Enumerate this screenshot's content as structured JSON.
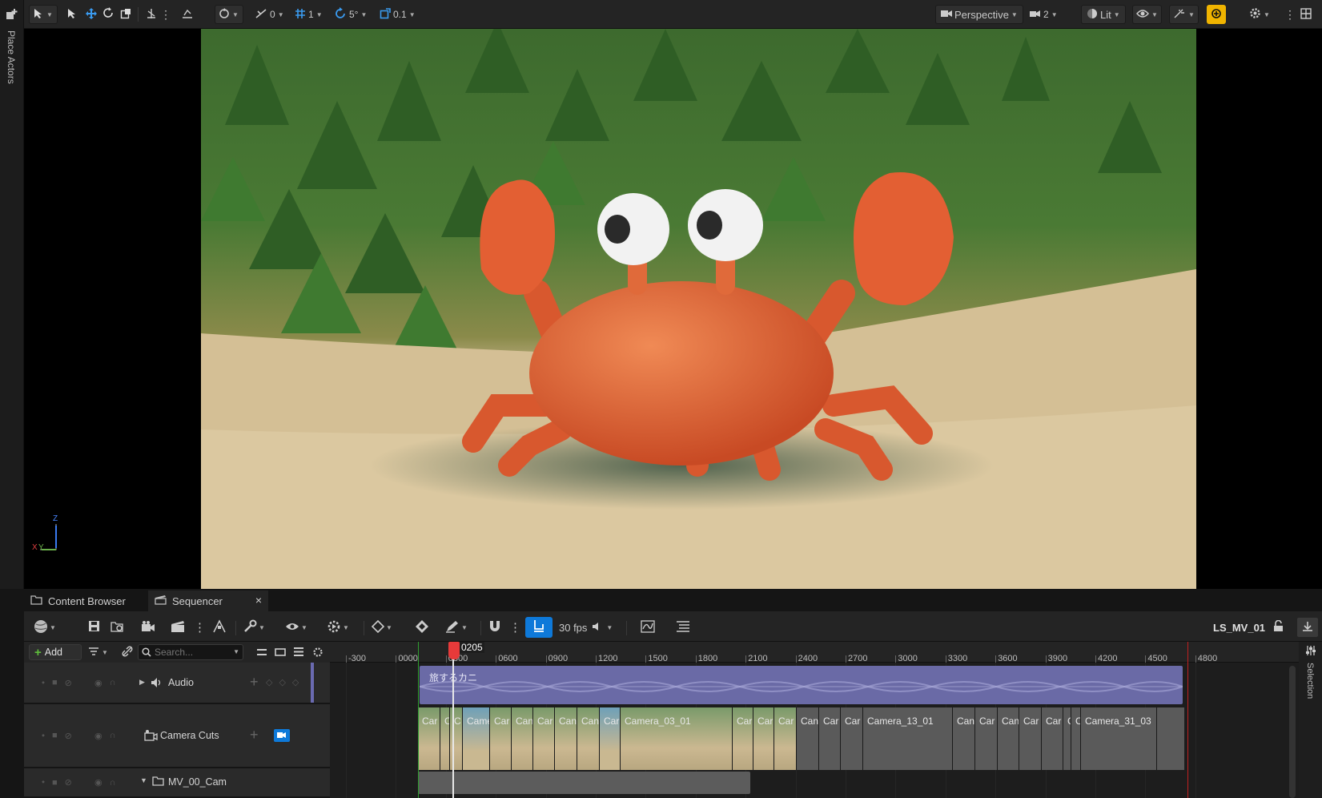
{
  "left_panel": {
    "place_actors_label": "Place Actors"
  },
  "toolbar": {
    "snap_translate": "0",
    "grid_size": "1",
    "rotation_snap": "5°",
    "scale_snap": "0.1",
    "view_mode": "Perspective",
    "camera_speed": "2",
    "lighting_mode": "Lit"
  },
  "viewport": {
    "axis_z": "Z",
    "axis_x": "X",
    "axis_y": "Y"
  },
  "tabs": [
    {
      "label": "Content Browser"
    },
    {
      "label": "Sequencer",
      "close": "×"
    }
  ],
  "sequencer": {
    "fps": "30 fps",
    "sequence_name": "LS_MV_01",
    "add_label": "Add",
    "search_placeholder": "Search...",
    "playhead_frame": "0205",
    "ruler_ticks": [
      "-300",
      "0000",
      "0300",
      "0600",
      "0900",
      "1200",
      "1500",
      "1800",
      "2100",
      "2400",
      "2700",
      "3000",
      "3300",
      "3600",
      "3900",
      "4200",
      "4500",
      "4800"
    ],
    "tracks": [
      {
        "label": "Audio"
      },
      {
        "label": "Camera Cuts"
      },
      {
        "label": "MV_00_Cam"
      }
    ],
    "audio_clip_label": "旅するカニ",
    "camera_clips": [
      "Car",
      "C",
      "C",
      "Came",
      "Car",
      "Can",
      "Car",
      "Can",
      "Can",
      "Car",
      "Camera_03_01",
      "Car",
      "Car",
      "Car",
      "Can",
      "Car",
      "Car",
      "Camera_13_01",
      "Can",
      "Car",
      "Can",
      "Car",
      "Car",
      "C",
      "C",
      "Camera_31_03"
    ],
    "side_label": "Selection"
  }
}
